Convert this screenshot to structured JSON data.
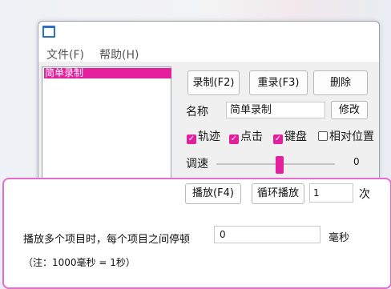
{
  "menu": [
    "文件(F)",
    "帮助(H)"
  ],
  "list": {
    "items": [
      "简单录制"
    ]
  },
  "buttons": {
    "record": "录制(F2)",
    "rerecord": "重录(F3)",
    "delete": "删除",
    "rename": "修改",
    "play": "播放(F4)",
    "loop": "循环播放"
  },
  "name": {
    "label": "名称",
    "value": "简单录制"
  },
  "options": [
    {
      "label": "轨迹",
      "checked": true
    },
    {
      "label": "点击",
      "checked": true
    },
    {
      "label": "键盘",
      "checked": true
    },
    {
      "label": "相对位置",
      "checked": false
    }
  ],
  "speed": {
    "label": "调速",
    "value": "0"
  },
  "loop": {
    "count": "1",
    "unit": "次"
  },
  "dialog": {
    "prompt": "播放多个项目时，每个项目之间停顿",
    "value": "0",
    "unit": "毫秒",
    "note": "（注：1000毫秒 = 1秒）"
  },
  "colors": {
    "accent": "#e31f9e",
    "dialog_border": "#e56ad2"
  }
}
